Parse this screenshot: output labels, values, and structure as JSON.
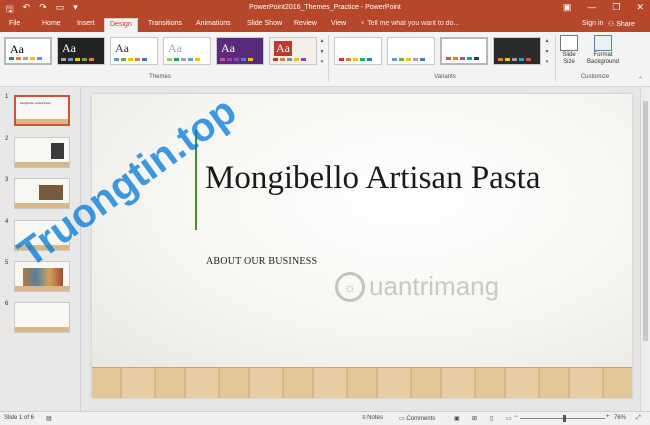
{
  "window": {
    "title": "PowerPoint2016_Themes_Practice - PowerPoint",
    "qat": [
      "save-icon",
      "undo-icon",
      "redo-icon",
      "start-presentation-icon",
      "customize-qat-icon"
    ],
    "controls": {
      "ribbon_options": "▣",
      "minimize": "—",
      "maximize": "❐",
      "close": "✕"
    }
  },
  "ribbon": {
    "tabs": [
      {
        "label": "File"
      },
      {
        "label": "Home"
      },
      {
        "label": "Insert"
      },
      {
        "label": "Design"
      },
      {
        "label": "Transitions"
      },
      {
        "label": "Animations"
      },
      {
        "label": "Slide Show"
      },
      {
        "label": "Review"
      },
      {
        "label": "View"
      }
    ],
    "active_tab": "Design",
    "tell_me": "Tell me what you want to do...",
    "sign_in": "Sign in",
    "share": "Share",
    "themes_label": "Themes",
    "variants_label": "Variants",
    "customize_label": "Customize",
    "slide_size": "Slide Size",
    "format_background": "Format Background",
    "theme_aa": "Aa"
  },
  "slides": [
    {
      "num": "1",
      "title": "Mongibello Artisan Pasta"
    },
    {
      "num": "2",
      "title": ""
    },
    {
      "num": "3",
      "title": ""
    },
    {
      "num": "4",
      "title": ""
    },
    {
      "num": "5",
      "title": ""
    },
    {
      "num": "6",
      "title": ""
    }
  ],
  "slide": {
    "title": "Mongibello Artisan Pasta",
    "subtitle": "ABOUT OUR BUSINESS"
  },
  "watermarks": {
    "left": "Truongtin.top",
    "right": "uantrimang"
  },
  "status": {
    "slide_info": "Slide 1 of 6",
    "notes": "Notes",
    "comments": "Comments",
    "zoom": "76%"
  },
  "colors": {
    "accent": "#b7472a",
    "selected_border": "#d35230",
    "title_line": "#4d8c2e"
  }
}
